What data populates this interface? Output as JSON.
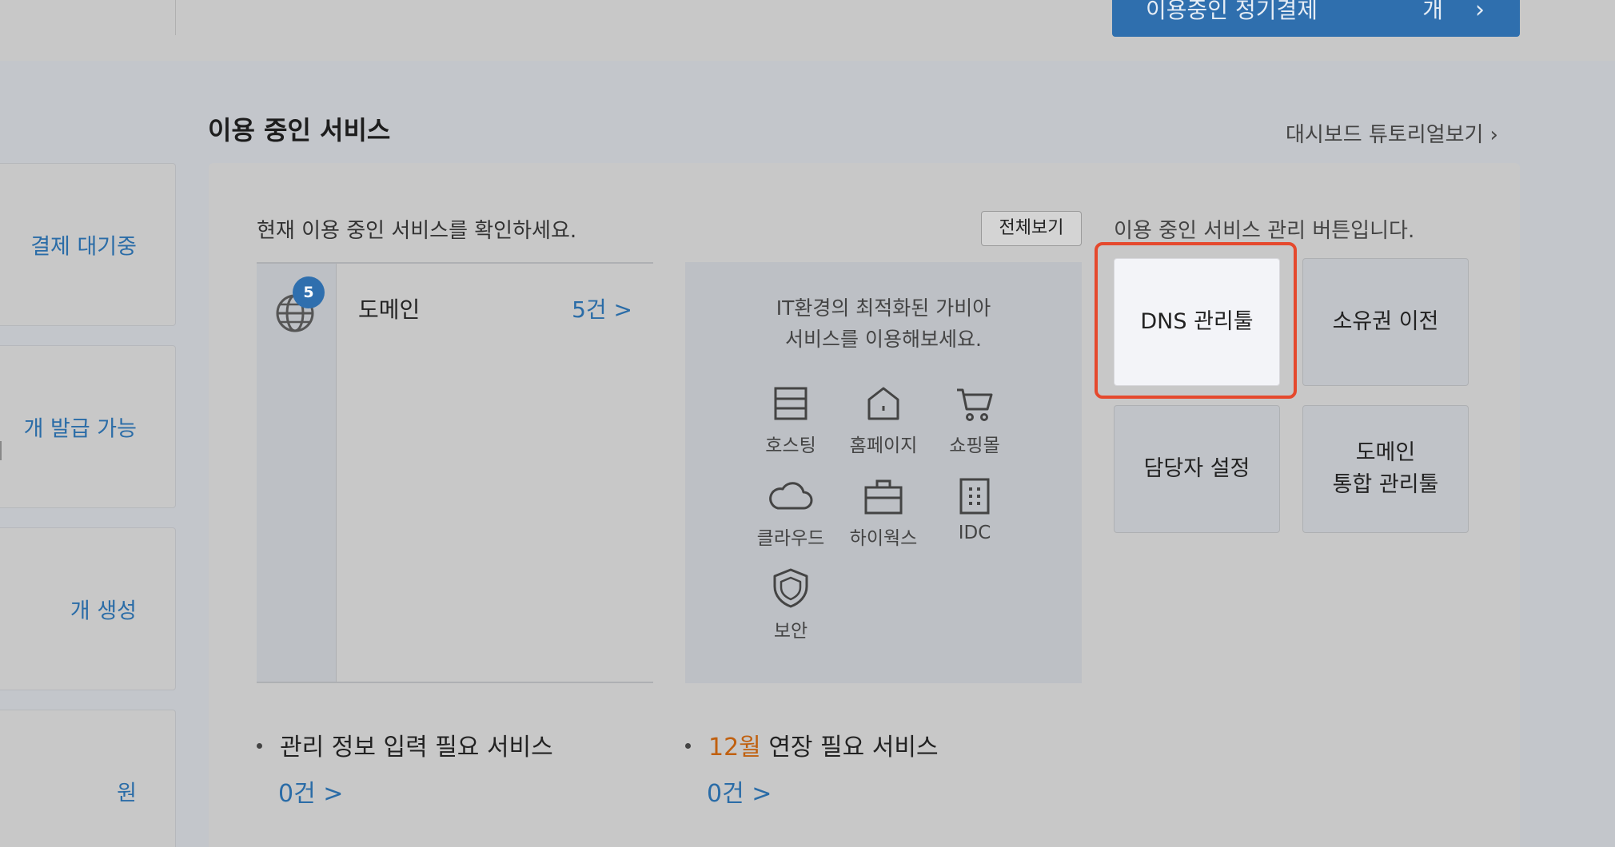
{
  "top_bar": {
    "subscription_button": "이용중인 정기결제",
    "subscription_suffix": "개",
    "chevron": "chevron-right-icon"
  },
  "left_cards": [
    {
      "label": "결제 대기중"
    },
    {
      "label": "개 발급 가능"
    },
    {
      "label": "개 생성"
    },
    {
      "label": "원"
    }
  ],
  "section": {
    "title": "이용 중인 서비스",
    "tutorial_link": "대시보드 튜토리얼보기"
  },
  "services": {
    "description": "현재 이용 중인 서비스를 확인하세요.",
    "view_all": "전체보기",
    "items": [
      {
        "name": "도메인",
        "count": "5건 >",
        "badge": "5",
        "icon": "globe-icon"
      }
    ]
  },
  "promo": {
    "line1": "IT환경의 최적화된 가비아",
    "line2": "서비스를 이용해보세요.",
    "items": [
      {
        "label": "호스팅",
        "icon": "hosting-icon"
      },
      {
        "label": "홈페이지",
        "icon": "home-icon"
      },
      {
        "label": "쇼핑몰",
        "icon": "cart-icon"
      },
      {
        "label": "클라우드",
        "icon": "cloud-icon"
      },
      {
        "label": "하이웍스",
        "icon": "briefcase-icon"
      },
      {
        "label": "IDC",
        "icon": "building-icon"
      },
      {
        "label": "보안",
        "icon": "shield-icon"
      }
    ]
  },
  "management": {
    "description": "이용 중인 서비스 관리 버튼입니다.",
    "buttons": [
      {
        "label": "DNS 관리툴"
      },
      {
        "label": "소유권 이전"
      },
      {
        "label": "담당자 설정"
      },
      {
        "label_line1": "도메인",
        "label_line2": "통합 관리툴"
      }
    ]
  },
  "bottom": {
    "info_required": "관리 정보 입력 필요 서비스",
    "info_required_count": "0건 >",
    "renewal_month": "12월",
    "renewal_label": " 연장 필요 서비스",
    "renewal_count": "0건 >"
  },
  "colors": {
    "accent": "#2f6fae",
    "link": "#2a6ca7",
    "highlight_border": "#e5492d",
    "month": "#c0600f"
  }
}
